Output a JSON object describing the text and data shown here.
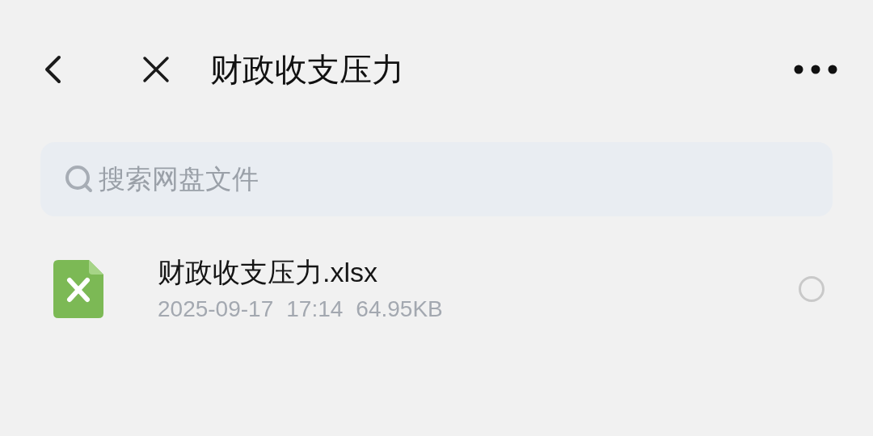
{
  "header": {
    "title": "财政收支压力"
  },
  "search": {
    "placeholder": "搜索网盘文件"
  },
  "files": [
    {
      "name": "财政收支压力.xlsx",
      "date": "2025-09-17",
      "time": "17:14",
      "size": "64.95KB",
      "selected": false
    }
  ]
}
